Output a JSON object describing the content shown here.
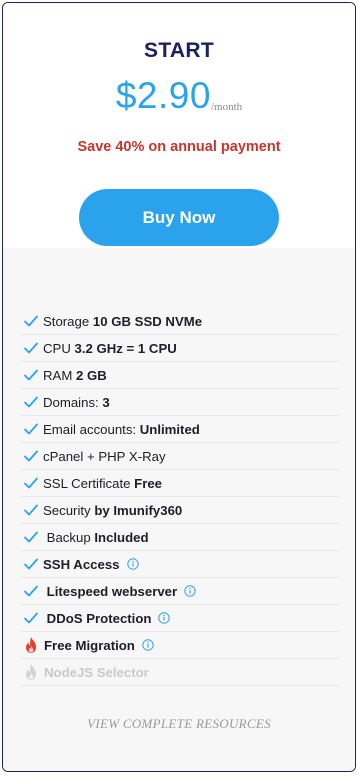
{
  "plan": {
    "name": "START",
    "price": "$2.90",
    "period": "/month",
    "save_text": "Save 40% on annual payment",
    "buy_label": "Buy Now"
  },
  "features": [
    {
      "label": "Storage",
      "value": "10 GB SSD NVMe"
    },
    {
      "label": "CPU",
      "value": "3.2 GHz = 1 CPU"
    },
    {
      "label": "RAM",
      "value": "2 GB"
    },
    {
      "label": "Domains:",
      "value": "3"
    },
    {
      "label": "Email accounts:",
      "value": "Unlimited"
    },
    {
      "label": "cPanel + PHP X-Ray",
      "value": ""
    },
    {
      "label": "SSL Certificate",
      "value": "Free"
    },
    {
      "label": "Security",
      "value": "by Imunify360"
    },
    {
      "label": "Backup",
      "value": "Included"
    },
    {
      "label": "SSH Access",
      "value": ""
    },
    {
      "label": "Litespeed webserver",
      "value": ""
    },
    {
      "label": "DDoS Protection",
      "value": ""
    },
    {
      "label": "Free Migration",
      "value": ""
    },
    {
      "label": "NodeJS Selector",
      "value": ""
    }
  ],
  "view_all_label": "VIEW COMPLETE RESOURCES",
  "colors": {
    "accent": "#2aa3ec",
    "title": "#1b1f5e",
    "save": "#c8352e",
    "flame": "#e63b2e",
    "muted": "#c9c9c9"
  },
  "icons": {
    "check": "check-icon",
    "info": "info-icon",
    "flame": "flame-icon"
  }
}
